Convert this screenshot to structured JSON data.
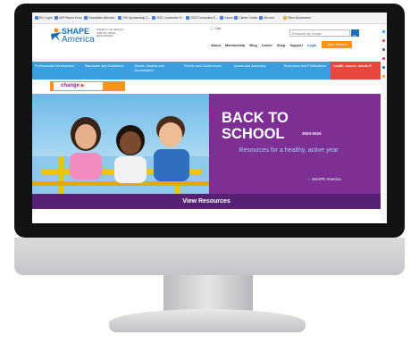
{
  "bookmarks": [
    {
      "label": "BIO Login"
    },
    {
      "label": "AEP Report Entry"
    },
    {
      "label": "Foundation (Benefa..."
    },
    {
      "label": "The Sponsorship C..."
    },
    {
      "label": "2021 Convention E..."
    },
    {
      "label": "2020 Convention E..."
    },
    {
      "label": "Canva"
    },
    {
      "label": "Career Center"
    },
    {
      "label": "Bill.com"
    },
    {
      "label": "Other Bookmarks"
    }
  ],
  "header": {
    "logo_line1": "SHAPE",
    "logo_line2": "America",
    "logo_sub": "SOCIETY OF HEALTH AND PHYSICAL EDUCATORS",
    "cart": "Cart",
    "search_placeholder": "Enhanced by Google",
    "top_links": [
      "About",
      "Membership",
      "Blog",
      "Career",
      "Shop",
      "Support",
      "Login"
    ],
    "join_label": "Join / Renew"
  },
  "nav": {
    "items": [
      {
        "label": "Professional Development"
      },
      {
        "label": "Standards and Guidelines"
      },
      {
        "label": "Grants, Awards and Accreditation"
      },
      {
        "label": "Events and Conferences"
      },
      {
        "label": "Issues and Advocacy"
      },
      {
        "label": "Resources and Publications"
      },
      {
        "label": "health. moves. minds.®"
      }
    ]
  },
  "change_label": "change",
  "hero": {
    "title_line1": "BACK TO",
    "title_line2": "SCHOOL",
    "year": "2023-2024",
    "subtitle": "Resources for a healthy, active year",
    "brand": "SHAPE America"
  },
  "view_resources": "View Resources",
  "colors": {
    "nav_blue": "#3a9fde",
    "accent_orange": "#f7941d",
    "hero_purple": "#7e2f94",
    "bar_purple": "#562172",
    "health_red": "#e8473d"
  }
}
